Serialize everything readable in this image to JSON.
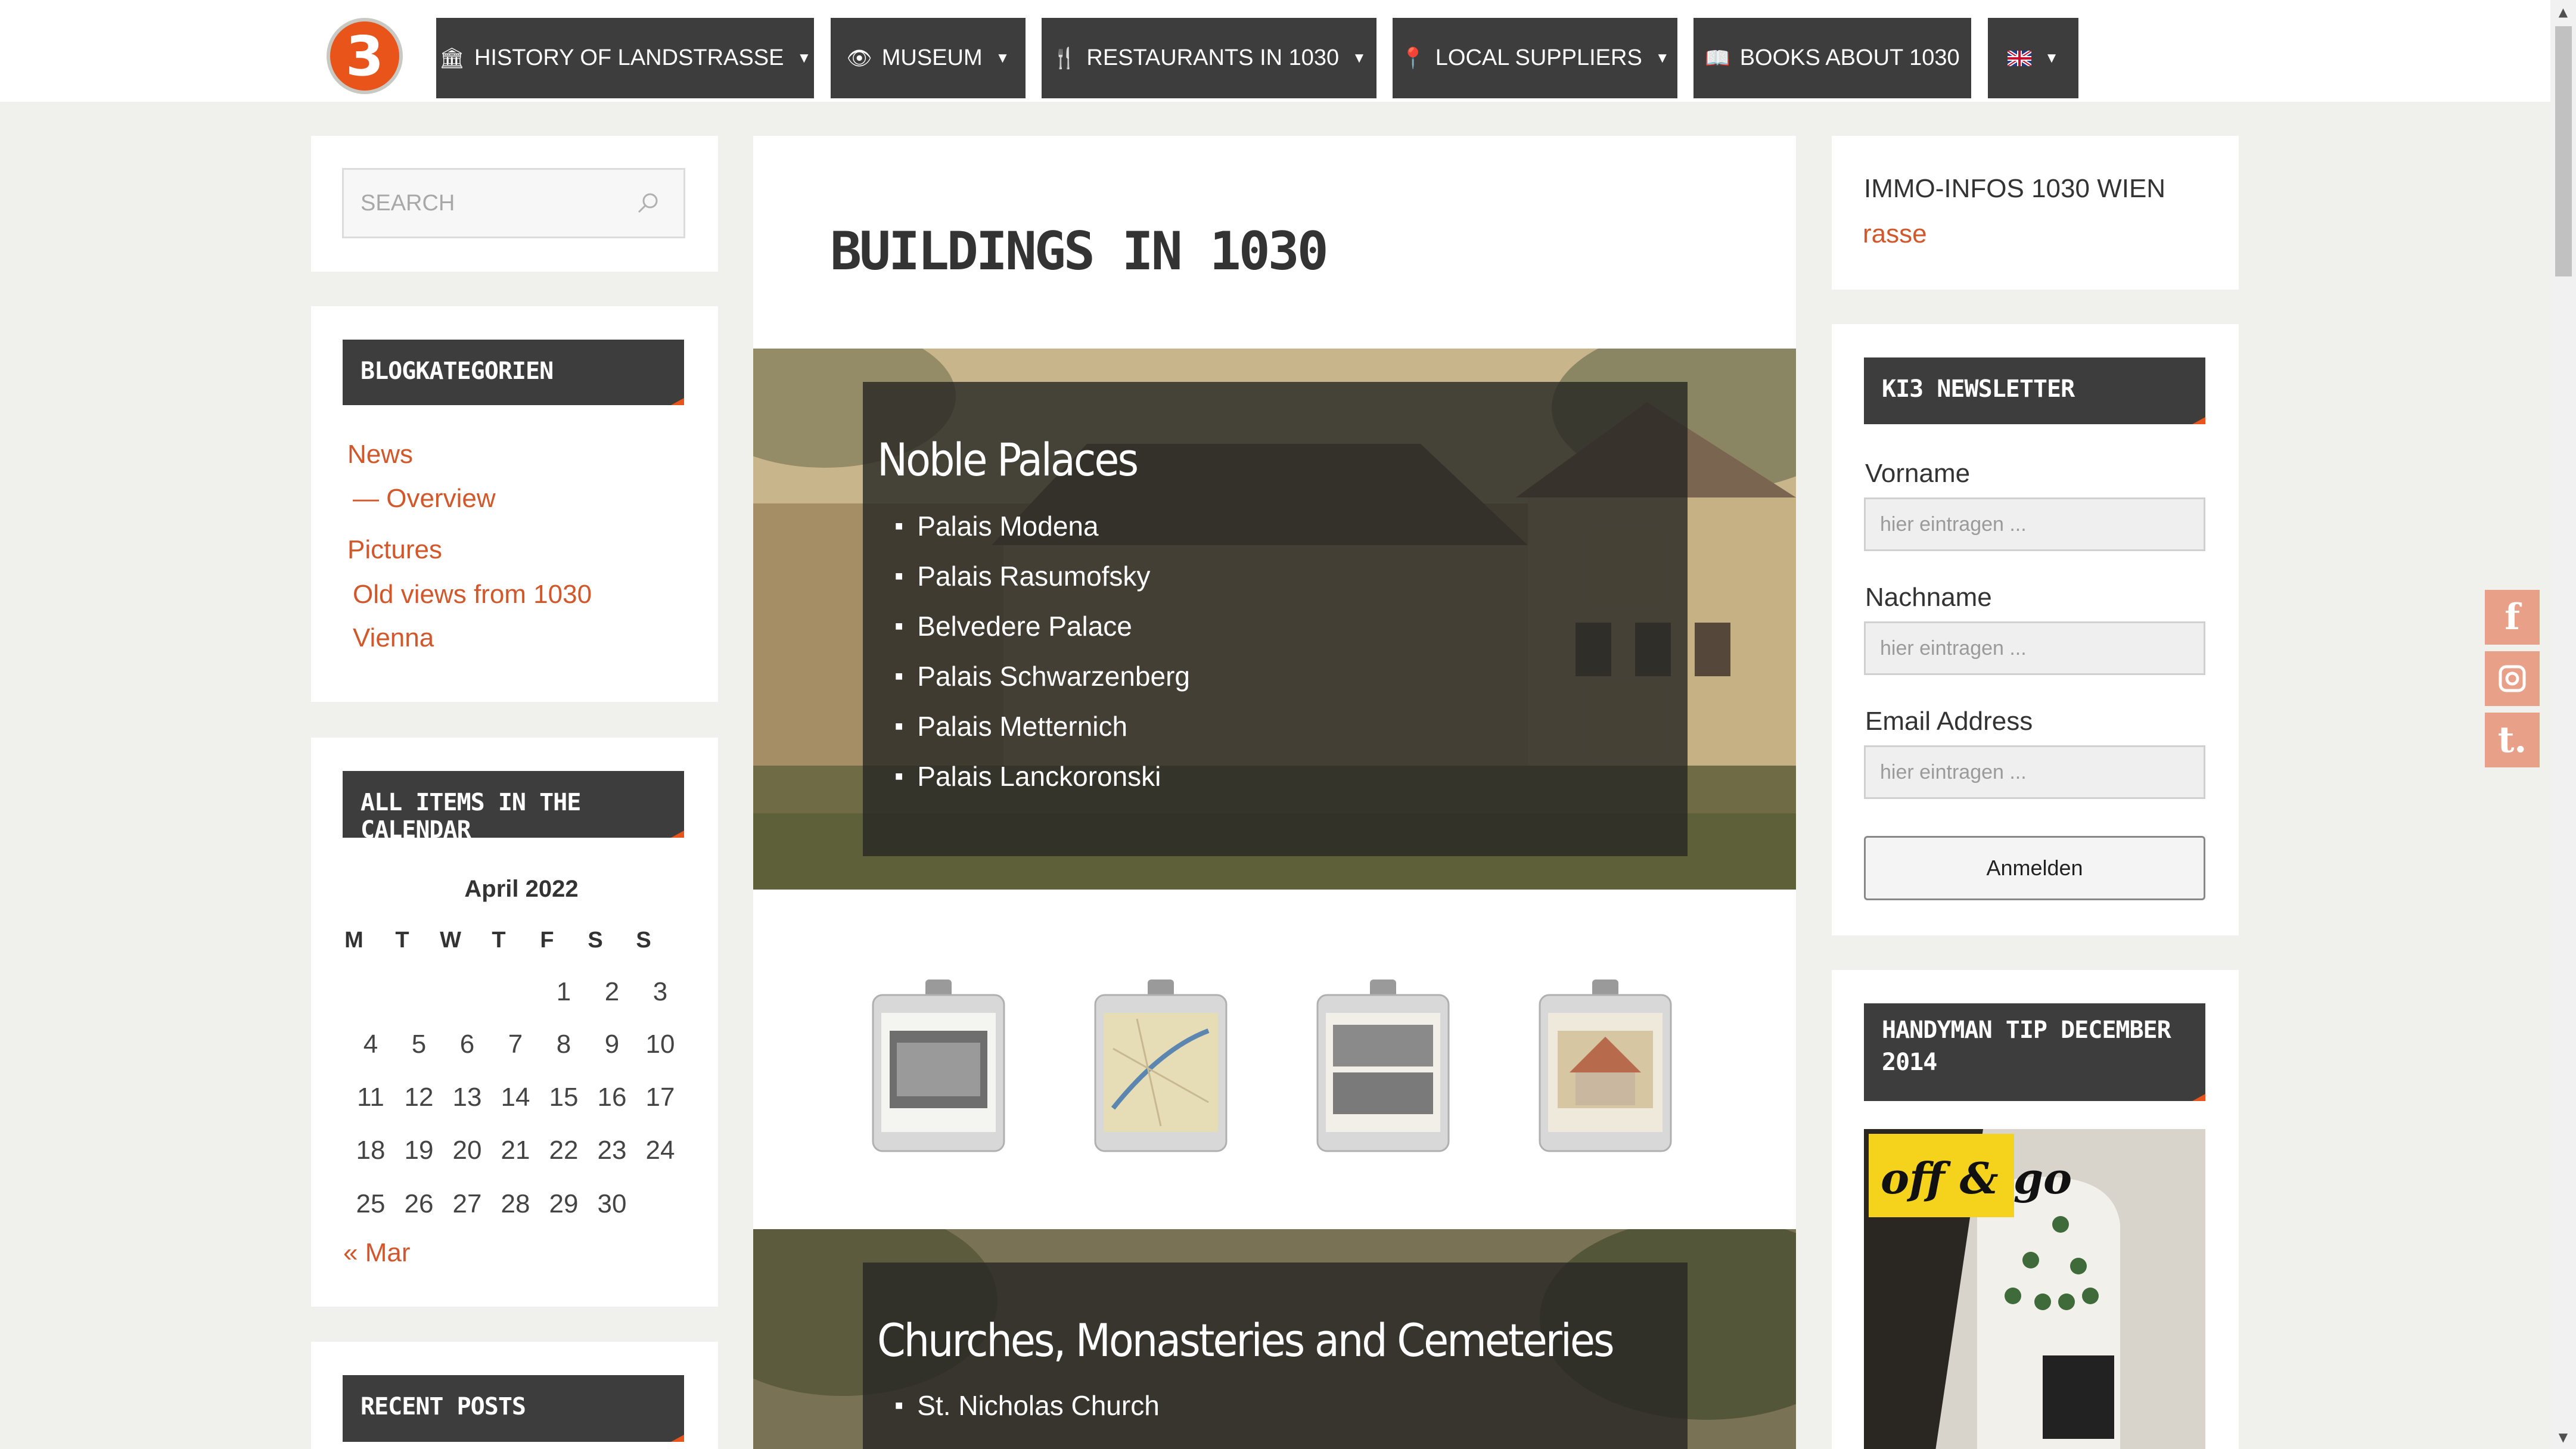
{
  "nav": {
    "logo_text": "3",
    "items": [
      {
        "icon": "landmark-icon",
        "glyph": "🏛",
        "label": "HISTORY OF LANDSTRASSE",
        "caret": true
      },
      {
        "icon": "eye-icon",
        "glyph": "👁",
        "label": "MUSEUM",
        "caret": true
      },
      {
        "icon": "cutlery-icon",
        "glyph": "🍴",
        "label": "RESTAURANTS IN 1030",
        "caret": true
      },
      {
        "icon": "map-pin-icon",
        "glyph": "📍",
        "label": "LOCAL SUPPLIERS",
        "caret": true
      },
      {
        "icon": "book-icon",
        "glyph": "📖",
        "label": "BOOKS ABOUT 1030",
        "caret": false
      },
      {
        "icon": "uk-flag-icon",
        "glyph": "",
        "label": "",
        "caret": true
      }
    ]
  },
  "search": {
    "placeholder": "SEARCH"
  },
  "categories": {
    "title": "BLOGKATEGORIEN",
    "items": [
      "News",
      "— Overview",
      "Pictures",
      "Old views from 1030",
      "Vienna"
    ]
  },
  "calendar": {
    "title": "ALL ITEMS IN THE CALENDAR",
    "caption": "April 2022",
    "weekdays": [
      "M",
      "T",
      "W",
      "T",
      "F",
      "S",
      "S"
    ],
    "weeks": [
      [
        "",
        "",
        "",
        "",
        "1",
        "2",
        "3"
      ],
      [
        "4",
        "5",
        "6",
        "7",
        "8",
        "9",
        "10"
      ],
      [
        "11",
        "12",
        "13",
        "14",
        "15",
        "16",
        "17"
      ],
      [
        "18",
        "19",
        "20",
        "21",
        "22",
        "23",
        "24"
      ],
      [
        "25",
        "26",
        "27",
        "28",
        "29",
        "30",
        ""
      ]
    ],
    "prev": "« Mar"
  },
  "recent_posts": {
    "title": "RECENT POSTS"
  },
  "main": {
    "title": "BUILDINGS IN 1030",
    "sections": [
      {
        "heading": "Noble Palaces",
        "items": [
          "Palais Modena",
          "Palais Rasumofsky",
          "Belvedere Palace",
          "Palais Schwarzenberg",
          "Palais Metternich",
          "Palais Lanckoronski"
        ]
      },
      {
        "heading": "Churches, Monasteries and Cemeteries",
        "items": [
          "St. Nicholas Church"
        ]
      }
    ]
  },
  "immo": {
    "title": "IMMO-INFOS 1030 WIEN",
    "link": "rasse"
  },
  "newsletter": {
    "title": "KI3 NEWSLETTER",
    "first_name_label": "Vorname",
    "first_name_placeholder": "hier eintragen ...",
    "last_name_label": "Nachname",
    "last_name_placeholder": "hier eintragen ...",
    "email_label": "Email Address",
    "email_placeholder": "hier eintragen ...",
    "submit": "Anmelden"
  },
  "handyman": {
    "title": "HANDYMAN TIP DECEMBER 2014",
    "image_sign": "off & go"
  },
  "social": [
    "facebook-icon",
    "instagram-icon",
    "tumblr-icon"
  ],
  "colors": {
    "accent": "#d2572a",
    "dark": "#3d3d3d",
    "logo": "#e8541a"
  }
}
